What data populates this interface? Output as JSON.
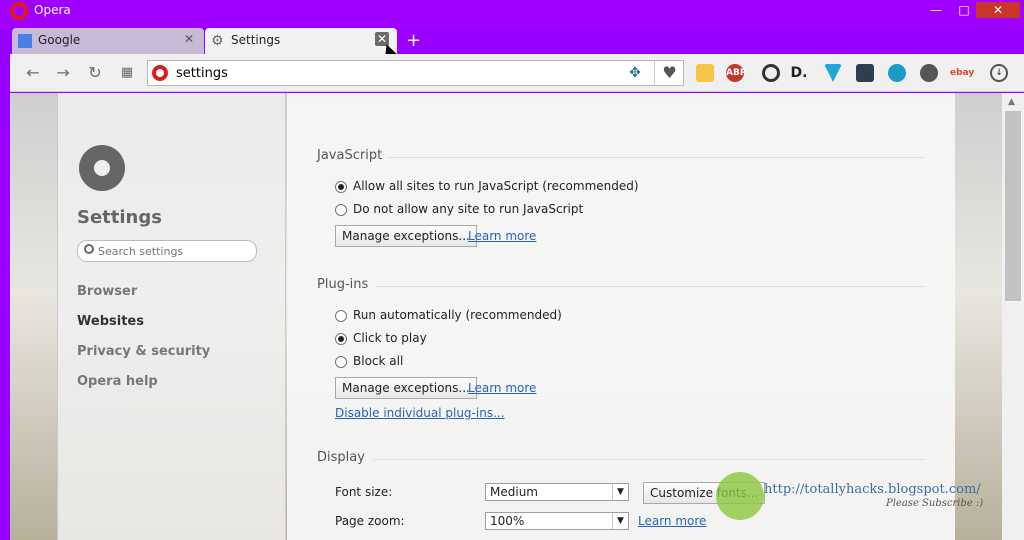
{
  "window": {
    "title": "Opera",
    "controls": {
      "minimize": "—",
      "maximize": "□",
      "close": "✕"
    }
  },
  "tabs": [
    {
      "label": "Google",
      "active": false
    },
    {
      "label": "Settings",
      "active": true
    }
  ],
  "toolbar": {
    "url": "settings",
    "extensions": [
      "ABP",
      "D.",
      "ebay"
    ]
  },
  "sidebar": {
    "title": "Settings",
    "search_placeholder": "Search settings",
    "nav": [
      {
        "label": "Browser",
        "active": false
      },
      {
        "label": "Websites",
        "active": true
      },
      {
        "label": "Privacy & security",
        "active": false
      },
      {
        "label": "Opera help",
        "active": false
      }
    ]
  },
  "sections": {
    "javascript": {
      "title": "JavaScript",
      "options": [
        "Allow all sites to run JavaScript (recommended)",
        "Do not allow any site to run JavaScript"
      ],
      "selected": 0,
      "manage_button": "Manage exceptions...",
      "learn_more": "Learn more"
    },
    "plugins": {
      "title": "Plug-ins",
      "options": [
        "Run automatically (recommended)",
        "Click to play",
        "Block all"
      ],
      "selected": 1,
      "manage_button": "Manage exceptions...",
      "learn_more": "Learn more",
      "disable_link": "Disable individual plug-ins..."
    },
    "display": {
      "title": "Display",
      "font_size_label": "Font size:",
      "font_size_value": "Medium",
      "customize_fonts": "Customize fonts...",
      "page_zoom_label": "Page zoom:",
      "page_zoom_value": "100%",
      "learn_more": "Learn more"
    }
  },
  "watermark": {
    "url": "http://totallyhacks.blogspot.com/",
    "sub": "Please Subscribe :)"
  }
}
